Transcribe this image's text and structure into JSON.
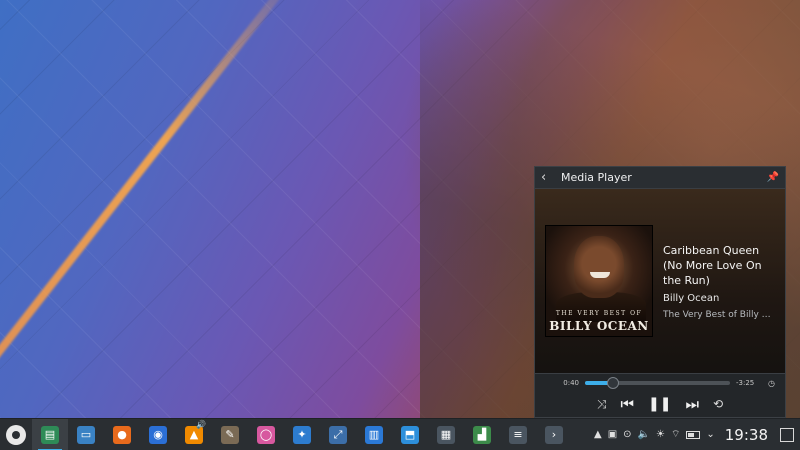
{
  "media_player": {
    "title": "Media Player",
    "track": {
      "title": "Caribbean Queen (No More Love On the Run)",
      "artist": "Billy Ocean",
      "album": "The Very Best of Billy Oce..."
    },
    "cover": {
      "subtitle": "THE VERY BEST OF",
      "title": "BILLY OCEAN"
    },
    "position": "0:40",
    "remaining": "-3:25",
    "progress_fraction": 0.19,
    "accent_color": "#3daee9",
    "icons": [
      "back-icon",
      "pin-icon",
      "shuffle-icon",
      "previous-icon",
      "pause-icon",
      "next-icon",
      "repeat-icon",
      "clock-icon"
    ]
  },
  "taskbar": {
    "tasks": [
      {
        "name": "system-monitor",
        "color": "#2e8b57",
        "glyph": "▤"
      },
      {
        "name": "file-manager",
        "color": "#3a82c4",
        "glyph": "▭"
      },
      {
        "name": "firefox",
        "color": "#e86a1c",
        "glyph": "●"
      },
      {
        "name": "thunderbird",
        "color": "#2b6fd6",
        "glyph": "◉"
      },
      {
        "name": "vlc",
        "color": "#f08a00",
        "glyph": "▲"
      },
      {
        "name": "gimp",
        "color": "#7a6a55",
        "glyph": "✎"
      },
      {
        "name": "media-app",
        "color": "#d7589f",
        "glyph": "◯"
      },
      {
        "name": "kdenlive",
        "color": "#2d7ccf",
        "glyph": "✦"
      },
      {
        "name": "kstars",
        "color": "#3c6ea8",
        "glyph": "⤢"
      },
      {
        "name": "writer",
        "color": "#2b79d6",
        "glyph": "▥"
      },
      {
        "name": "discover",
        "color": "#2d8fdb",
        "glyph": "⬒"
      },
      {
        "name": "calculator",
        "color": "#4a5560",
        "glyph": "▦"
      },
      {
        "name": "chart-app",
        "color": "#3c8b4a",
        "glyph": "▟"
      },
      {
        "name": "settings",
        "color": "#4a5560",
        "glyph": "≡"
      },
      {
        "name": "terminal",
        "color": "#4a5560",
        "glyph": "›"
      }
    ],
    "clock": "19:38"
  }
}
